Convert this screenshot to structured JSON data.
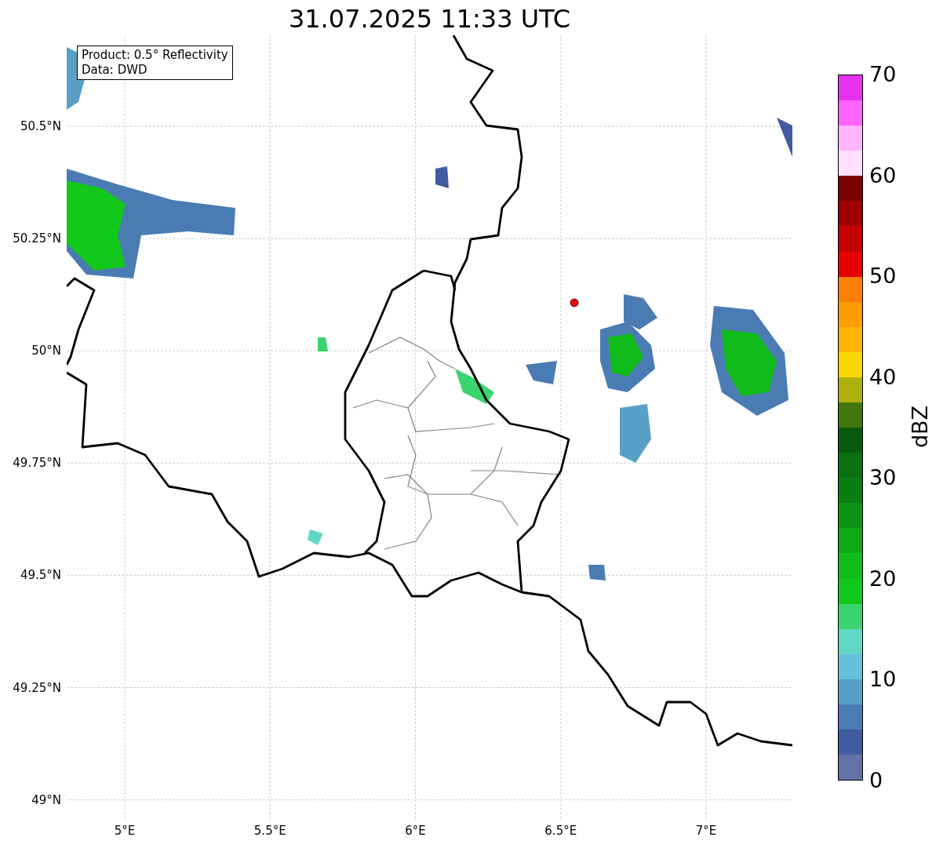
{
  "title": "31.07.2025 11:33 UTC",
  "legend": [
    "Product: 0.5° Reflectivity",
    "Data: DWD"
  ],
  "map": {
    "yticks": [
      "50.5°N",
      "50.25°N",
      "50°N",
      "49.75°N",
      "49.5°N",
      "49.25°N",
      "49°N"
    ],
    "xticks": [
      "5°E",
      "5.5°E",
      "6°E",
      "6.5°E",
      "7°E"
    ]
  },
  "colorbar": {
    "label": "dBZ",
    "ticks": [
      "70",
      "60",
      "50",
      "40",
      "30",
      "20",
      "10",
      "0"
    ],
    "bins": [
      {
        "color": "#e632f0"
      },
      {
        "color": "#ff64ff"
      },
      {
        "color": "#ffb4ff"
      },
      {
        "color": "#ffdefe"
      },
      {
        "color": "#7d0000"
      },
      {
        "color": "#a20000"
      },
      {
        "color": "#c50000"
      },
      {
        "color": "#e60000"
      },
      {
        "color": "#ff7f00"
      },
      {
        "color": "#ff9c00"
      },
      {
        "color": "#ffb400"
      },
      {
        "color": "#ffd700"
      },
      {
        "color": "#aeb00a"
      },
      {
        "color": "#43760c"
      },
      {
        "color": "#065c0c"
      },
      {
        "color": "#08700f"
      },
      {
        "color": "#0a7e12"
      },
      {
        "color": "#0c9416"
      },
      {
        "color": "#0ea818"
      },
      {
        "color": "#10bb1a"
      },
      {
        "color": "#12c81a"
      },
      {
        "color": "#3bd46f"
      },
      {
        "color": "#5ed8c4"
      },
      {
        "color": "#67c0dc"
      },
      {
        "color": "#58a0c8"
      },
      {
        "color": "#4a7bb3"
      },
      {
        "color": "#405ba0"
      },
      {
        "color": "#6272a6"
      }
    ]
  }
}
